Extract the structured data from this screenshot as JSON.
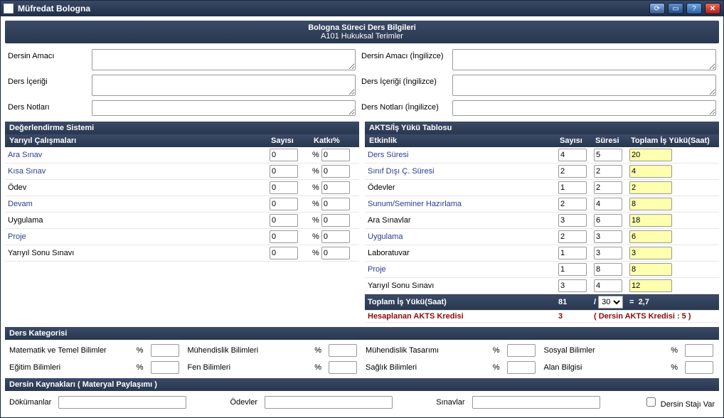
{
  "window": {
    "title": "Müfredat Bologna",
    "buttons": {
      "refresh": "⟳",
      "min": "▭",
      "help": "?",
      "close": "✕"
    }
  },
  "banner": {
    "line1": "Bologna Süreci Ders Bilgileri",
    "line2": "A101 Hukuksal Terimler"
  },
  "desc": {
    "labels": {
      "amac": "Dersin Amacı",
      "icerik": "Ders İçeriği",
      "not": "Ders Notları",
      "amac_en": "Dersin Amacı (İngilizce)",
      "icerik_en": "Ders İçeriği (İngilizce)",
      "not_en": "Ders Notları (İngilizce)"
    },
    "values": {
      "amac": "",
      "icerik": "",
      "not": "",
      "amac_en": "",
      "icerik_en": "",
      "not_en": ""
    }
  },
  "eval": {
    "title": "Değerlendirme Sistemi",
    "headers": {
      "item": "Yarıyıl Çalışmaları",
      "count": "Sayısı",
      "pct": "Katkı%"
    },
    "rows": [
      {
        "label": "Ara Sınav",
        "count": "0",
        "pct": "0",
        "link": true
      },
      {
        "label": "Kısa Sınav",
        "count": "0",
        "pct": "0",
        "link": true
      },
      {
        "label": "Ödev",
        "count": "0",
        "pct": "0",
        "link": false
      },
      {
        "label": "Devam",
        "count": "0",
        "pct": "0",
        "link": true
      },
      {
        "label": "Uygulama",
        "count": "0",
        "pct": "0",
        "link": false
      },
      {
        "label": "Proje",
        "count": "0",
        "pct": "0",
        "link": true
      },
      {
        "label": "Yarıyıl Sonu Sınavı",
        "count": "0",
        "pct": "0",
        "link": false
      }
    ],
    "pct_prefix": "%"
  },
  "akts": {
    "title": "AKTS/İş Yükü Tablosu",
    "headers": {
      "act": "Etkinlik",
      "count": "Sayısı",
      "dur": "Süresi",
      "total": "Toplam İş Yükü(Saat)"
    },
    "rows": [
      {
        "label": "Ders Süresi",
        "count": "4",
        "dur": "5",
        "total": "20",
        "link": true
      },
      {
        "label": "Sınıf Dışı Ç. Süresi",
        "count": "2",
        "dur": "2",
        "total": "4",
        "link": true
      },
      {
        "label": "Ödevler",
        "count": "1",
        "dur": "2",
        "total": "2",
        "link": false
      },
      {
        "label": "Sunum/Seminer Hazırlama",
        "count": "2",
        "dur": "4",
        "total": "8",
        "link": true
      },
      {
        "label": "Ara Sınavlar",
        "count": "3",
        "dur": "6",
        "total": "18",
        "link": false
      },
      {
        "label": "Uygulama",
        "count": "2",
        "dur": "3",
        "total": "6",
        "link": true
      },
      {
        "label": "Laboratuvar",
        "count": "1",
        "dur": "3",
        "total": "3",
        "link": false
      },
      {
        "label": "Proje",
        "count": "1",
        "dur": "8",
        "total": "8",
        "link": true
      },
      {
        "label": "Yarıyıl Sonu Sınavı",
        "count": "3",
        "dur": "4",
        "total": "12",
        "link": false
      }
    ],
    "total_label": "Toplam İş Yükü(Saat)",
    "total_value": "81",
    "slash": "/",
    "divisor": "30",
    "eq": "=",
    "result": "2,7",
    "calc_label": "Hesaplanan AKTS Kredisi",
    "calc_value": "3",
    "calc_note": "( Dersin AKTS Kredisi : 5 )"
  },
  "categories": {
    "title": "Ders Kategorisi",
    "items": [
      {
        "label": "Matematik ve Temel Bilimler",
        "value": ""
      },
      {
        "label": "Mühendislik Bilimleri",
        "value": ""
      },
      {
        "label": "Mühendislik Tasarımı",
        "value": ""
      },
      {
        "label": "Sosyal Bilimler",
        "value": ""
      },
      {
        "label": "Eğitim Bilimleri",
        "value": ""
      },
      {
        "label": "Fen Bilimleri",
        "value": ""
      },
      {
        "label": "Sağlık Bilimleri",
        "value": ""
      },
      {
        "label": "Alan Bilgisi",
        "value": ""
      }
    ],
    "pct": "%"
  },
  "resources": {
    "title": "Dersin Kaynakları ( Materyal Paylaşımı )",
    "docs_label": "Dökümanlar",
    "hw_label": "Ödevler",
    "exams_label": "Sınavlar",
    "intern_label": "Dersin Stajı Var",
    "docs": "",
    "hw": "",
    "exams": ""
  }
}
